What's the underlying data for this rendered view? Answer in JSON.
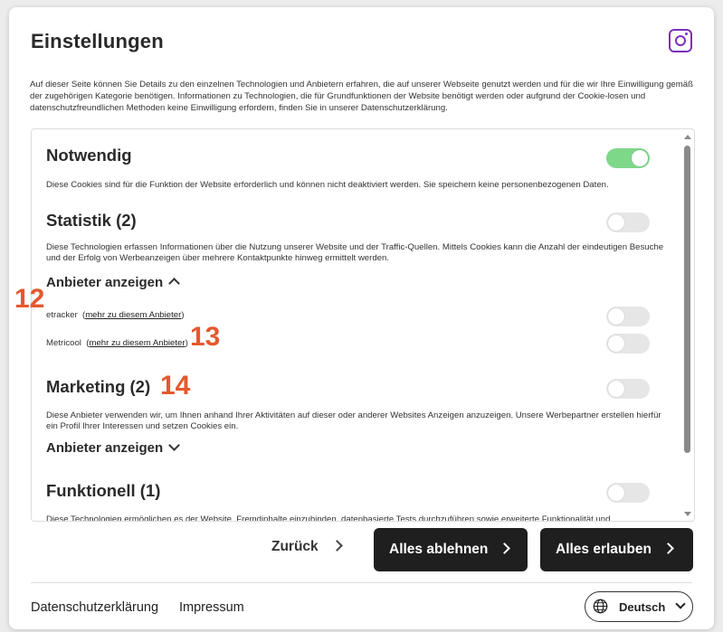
{
  "dialog": {
    "title": "Einstellungen",
    "icon": "camera-icon",
    "intro": "Auf dieser Seite können Sie Details zu den einzelnen Technologien und Anbietern erfahren, die auf unserer Webseite genutzt werden und für die wir Ihre Einwilligung gemäß der zugehörigen Kategorie benötigen. Informationen zu Technologien, die für Grundfunktionen der Website benötigt werden oder aufgrund der Cookie-losen und datenschutzfreundlichen Methoden keine Einwilligung erfordern, finden Sie in unserer Datenschutzerklärung."
  },
  "categories": {
    "necessary": {
      "title": "Notwendig",
      "enabled": true,
      "description": "Diese Cookies sind für die Funktion der Website erforderlich und können nicht deaktiviert werden. Sie speichern keine personenbezogenen Daten."
    },
    "statistics": {
      "title": "Statistik (2)",
      "enabled": false,
      "description": "Diese Technologien erfassen Informationen über die Nutzung unserer Website und der Traffic-Quellen. Mittels Cookies kann die Anzahl der eindeutigen Besuche und der Erfolg von Werbeanzeigen über mehrere Kontaktpunkte hinweg ermittelt werden.",
      "vendors_toggle": "Anbieter anzeigen",
      "vendors": [
        {
          "name": "etracker",
          "link": "mehr zu diesem Anbieter",
          "enabled": false
        },
        {
          "name": "Metricool",
          "link": "mehr zu diesem Anbieter",
          "enabled": false
        }
      ]
    },
    "marketing": {
      "title": "Marketing (2)",
      "enabled": false,
      "description": "Diese Anbieter verwenden wir, um Ihnen anhand Ihrer Aktivitäten auf dieser oder anderer Websites Anzeigen anzuzeigen. Unsere Werbepartner erstellen hierfür ein Profil Ihrer Interessen und setzen Cookies ein.",
      "vendors_toggle": "Anbieter anzeigen"
    },
    "functional": {
      "title": "Funktionell (1)",
      "enabled": false,
      "description": "Diese Technologien ermöglichen es der Website, Fremdinhalte einzubinden, datenbasierte Tests durchzuführen sowie erweiterte Funktionalität und"
    }
  },
  "annotations": [
    "12",
    "13",
    "14"
  ],
  "actions": {
    "back": "Zurück",
    "reject_all": "Alles ablehnen",
    "accept_all": "Alles erlauben"
  },
  "footer": {
    "privacy": "Datenschutzerklärung",
    "imprint": "Impressum",
    "language": "Deutsch"
  },
  "colors": {
    "toggle_on": "#7ed88a",
    "toggle_off": "#e6e6e6",
    "annotation": "#e5582f",
    "button_dark": "#1f1f1f",
    "icon_accent": "#7b2fbf"
  }
}
